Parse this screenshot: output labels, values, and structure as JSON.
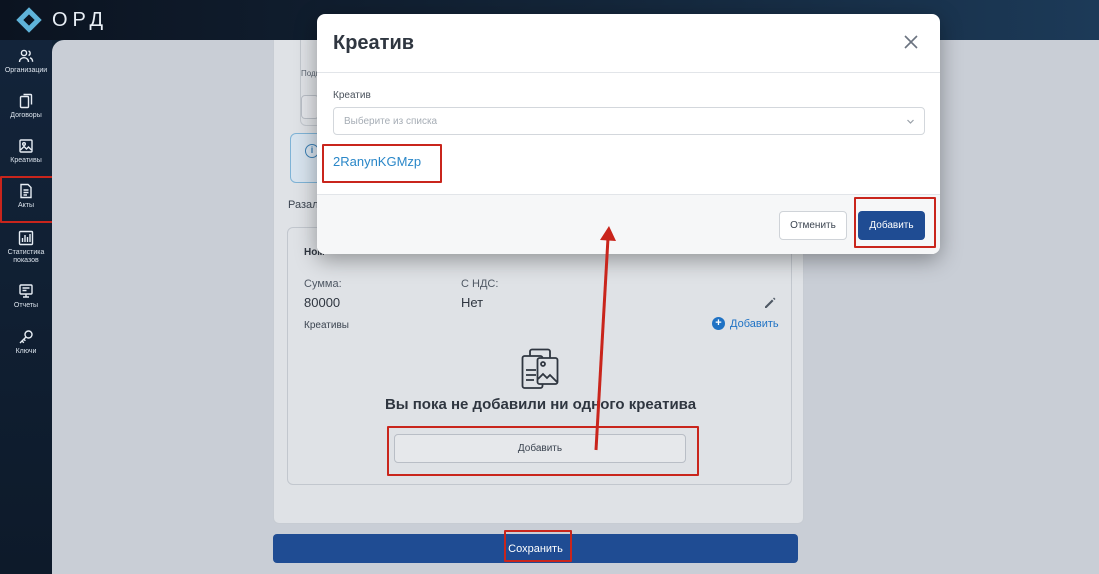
{
  "app": {
    "logo_text": "ОРД"
  },
  "sidebar": {
    "items": [
      {
        "label": "Организации",
        "icon": "users-icon"
      },
      {
        "label": "Договоры",
        "icon": "documents-icon"
      },
      {
        "label": "Креативы",
        "icon": "image-icon"
      },
      {
        "label": "Акты",
        "icon": "document-icon",
        "active": true
      },
      {
        "label": "Статистика",
        "label2": "показов",
        "icon": "stats-icon"
      },
      {
        "label": "Отчеты",
        "icon": "report-icon"
      },
      {
        "label": "Ключи",
        "icon": "key-icon"
      }
    ]
  },
  "form": {
    "podp_label": "Подп",
    "razm_label": "Разал",
    "item": {
      "title": "Ном",
      "sum_label": "Сумма:",
      "sum_value": "80000",
      "vat_label": "С НДС:",
      "vat_value": "Нет",
      "creatives_label": "Креативы",
      "add_link": "Добавить",
      "empty_text": "Вы пока не добавили ни одного креатива",
      "add_button": "Добавить"
    },
    "save_button": "Сохранить"
  },
  "modal": {
    "title": "Креатив",
    "field_label": "Креатив",
    "select_placeholder": "Выберите из списка",
    "selected_creative": "2RanynKGMzp",
    "cancel_button": "Отменить",
    "confirm_button": "Добавить"
  },
  "colors": {
    "accent": "#1f4c93",
    "link": "#2a87c8",
    "highlight": "#c9251c"
  }
}
